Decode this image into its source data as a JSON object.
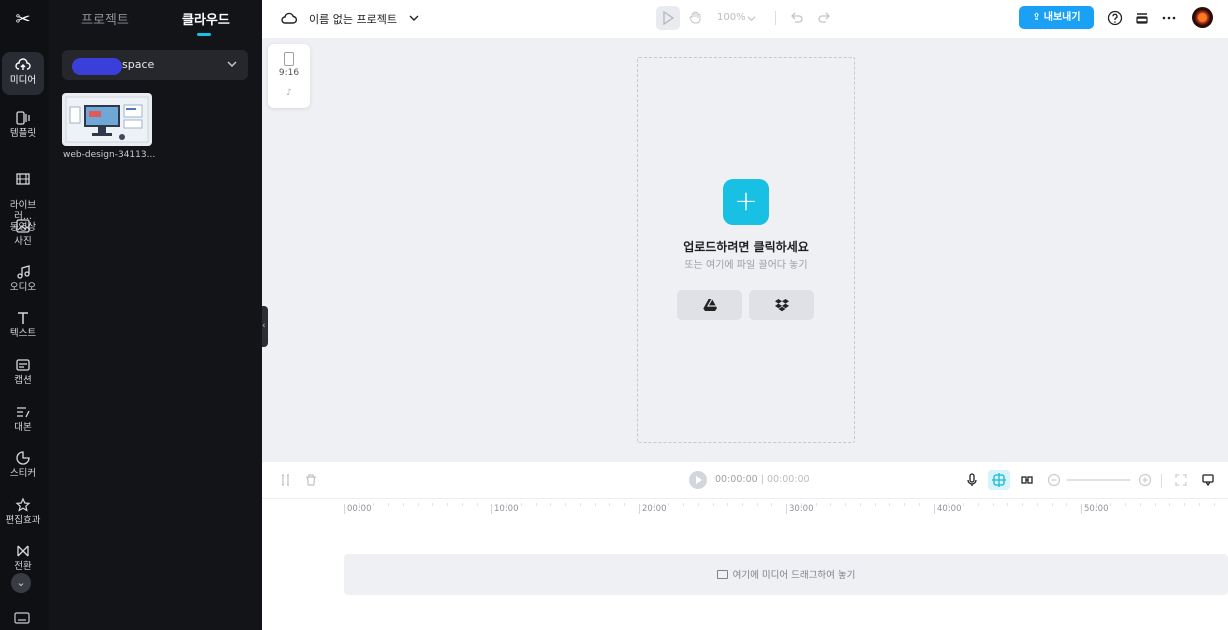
{
  "rail": {
    "items": [
      {
        "label": "미디어",
        "icon": "cloud-upload-icon"
      },
      {
        "label": "템플릿",
        "icon": "template-icon"
      },
      {
        "label": "라이브러...\n동영상",
        "icon": "film-icon"
      },
      {
        "label": "사진",
        "icon": "image-icon"
      },
      {
        "label": "오디오",
        "icon": "music-icon"
      },
      {
        "label": "텍스트",
        "icon": "text-icon"
      },
      {
        "label": "캡션",
        "icon": "caption-icon"
      },
      {
        "label": "대본",
        "icon": "script-icon"
      },
      {
        "label": "스티커",
        "icon": "sticker-icon"
      },
      {
        "label": "편집효과",
        "icon": "effects-icon"
      },
      {
        "label": "전환",
        "icon": "transition-icon"
      }
    ]
  },
  "panel": {
    "tabs": [
      "프로젝트",
      "클라우드"
    ],
    "active_tab": "클라우드",
    "space_label": "space",
    "files": [
      {
        "name": "web-design-34113..."
      }
    ]
  },
  "topbar": {
    "project_title": "이름 없는 프로젝트",
    "zoom": "100%",
    "export_label": "내보내기"
  },
  "aspect": {
    "label": "9:16"
  },
  "canvas": {
    "upload_title": "업로드하려면 클릭하세요",
    "upload_sub": "또는 여기에 파일 끌어다 놓기"
  },
  "timeline": {
    "current_time": "00:00:00",
    "total_time": "00:00:00",
    "ticks": [
      "00:00",
      "10:00",
      "20:00",
      "30:00",
      "40:00",
      "50:00"
    ],
    "drop_label": "여기에 미디어 드래그하여 놓기"
  },
  "colors": {
    "accent": "#18c0e4",
    "export": "#1aa0f5",
    "rail_bg": "#0f1013",
    "panel_bg": "#131417"
  }
}
